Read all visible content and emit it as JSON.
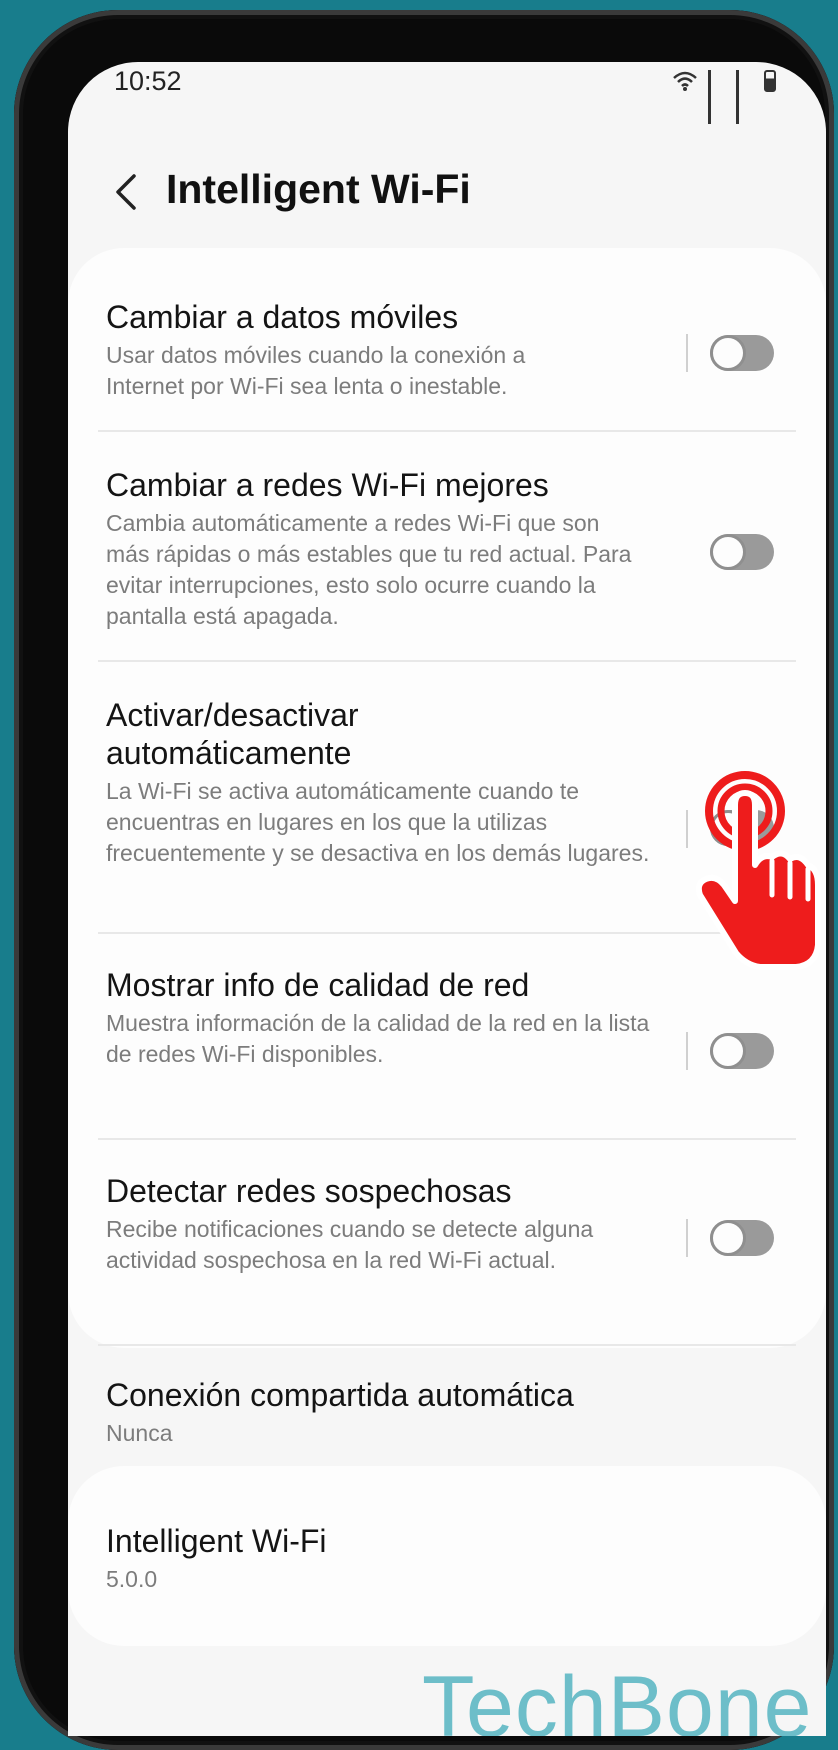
{
  "status_bar": {
    "time": "10:52"
  },
  "header": {
    "title": "Intelligent Wi-Fi"
  },
  "settings": [
    {
      "title": "Cambiar a datos móviles",
      "description": "Usar datos móviles cuando la conexión a Internet por Wi-Fi sea lenta o inestable.",
      "toggle": false
    },
    {
      "title": "Cambiar a redes Wi-Fi mejores",
      "description": "Cambia automáticamente a redes Wi-Fi que son más rápidas o más estables que tu red actual. Para evitar interrupciones, esto solo ocurre cuando la pantalla está apagada.",
      "toggle": false
    },
    {
      "title": "Activar/desactivar automáticamente",
      "description": "La Wi-Fi se activa automáticamente cuando te encuentras en lugares en los que la utilizas frecuentemente y se desactiva en los demás lugares.",
      "toggle": false
    },
    {
      "title": "Mostrar info de calidad de red",
      "description": "Muestra información de la calidad de la red en la lista de redes Wi-Fi disponibles.",
      "toggle": false
    },
    {
      "title": "Detectar redes sospechosas",
      "description": "Recibe notificaciones cuando se detecte alguna actividad sospechosa en la red Wi-Fi actual.",
      "toggle": false
    },
    {
      "title": "Conexión compartida automática",
      "description": "Nunca"
    }
  ],
  "about": {
    "title": "Intelligent Wi-Fi",
    "version": "5.0.0"
  },
  "watermark": "TechBone",
  "colors": {
    "background": "#187d8c",
    "watermark": "#6dbec9",
    "hand": "#ee1c1c"
  }
}
